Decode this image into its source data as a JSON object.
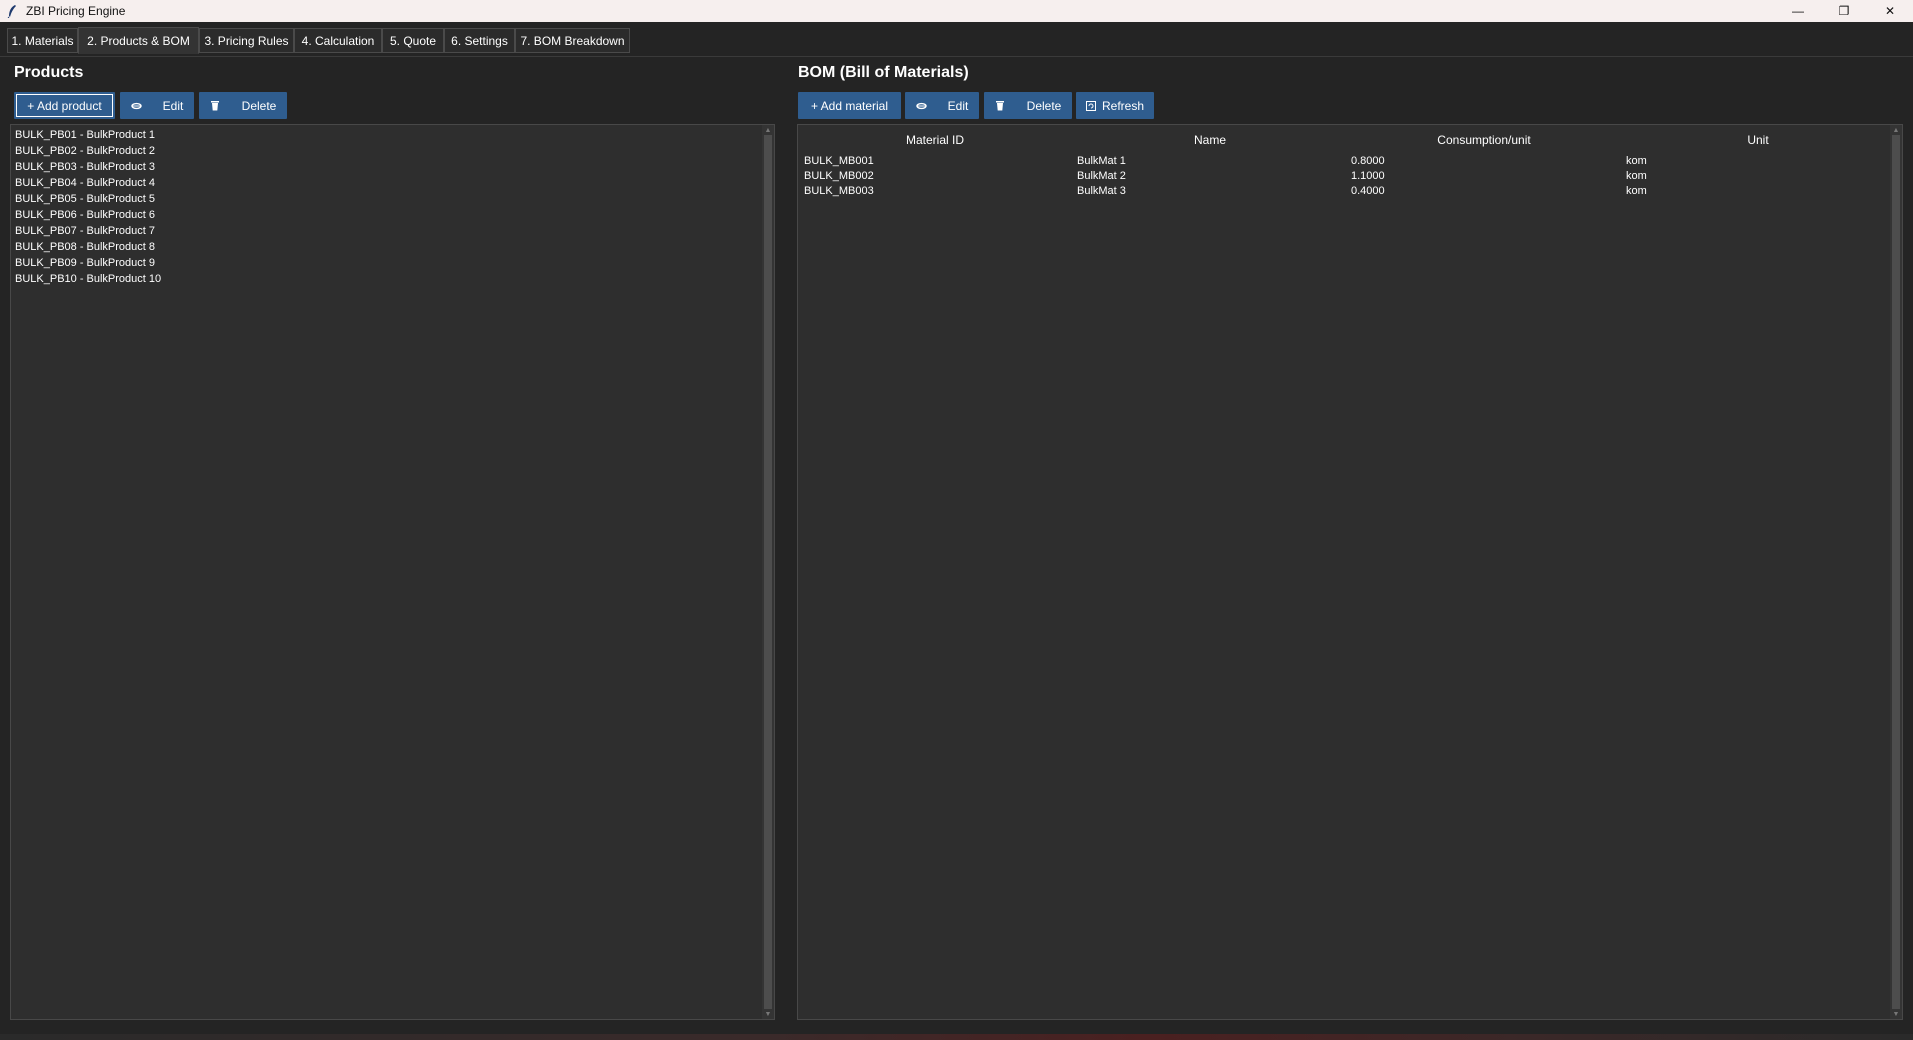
{
  "window": {
    "title": "ZBI Pricing Engine",
    "minimize_glyph": "—",
    "restore_glyph": "❐",
    "close_glyph": "✕"
  },
  "tabs": [
    {
      "label": "1. Materials"
    },
    {
      "label": "2. Products & BOM"
    },
    {
      "label": "3. Pricing Rules"
    },
    {
      "label": "4. Calculation"
    },
    {
      "label": "5. Quote"
    },
    {
      "label": "6. Settings"
    },
    {
      "label": "7. BOM Breakdown"
    }
  ],
  "active_tab": "2. Products & BOM",
  "products": {
    "title": "Products",
    "buttons": {
      "add": "+ Add product",
      "edit": "Edit",
      "delete": "Delete"
    },
    "items": [
      "BULK_PB01 - BulkProduct 1",
      "BULK_PB02 - BulkProduct 2",
      "BULK_PB03 - BulkProduct 3",
      "BULK_PB04 - BulkProduct 4",
      "BULK_PB05 - BulkProduct 5",
      "BULK_PB06 - BulkProduct 6",
      "BULK_PB07 - BulkProduct 7",
      "BULK_PB08 - BulkProduct 8",
      "BULK_PB09 - BulkProduct 9",
      "BULK_PB10 - BulkProduct 10"
    ]
  },
  "bom": {
    "title": "BOM (Bill of Materials)",
    "buttons": {
      "add": "+ Add material",
      "edit": "Edit",
      "delete": "Delete",
      "refresh": "Refresh"
    },
    "columns": [
      "Material ID",
      "Name",
      "Consumption/unit",
      "Unit"
    ],
    "rows": [
      [
        "BULK_MB001",
        "BulkMat 1",
        "0.8000",
        "kom"
      ],
      [
        "BULK_MB002",
        "BulkMat 2",
        "1.1000",
        "kom"
      ],
      [
        "BULK_MB003",
        "BulkMat 3",
        "0.4000",
        "kom"
      ]
    ]
  },
  "colors": {
    "button_bg": "#2f5d8f",
    "panel_bg": "#2e2e2e",
    "window_bg": "#242424",
    "titlebar_bg": "#f6efee"
  },
  "icons": {
    "edit": "pencil-icon",
    "delete": "trash-icon",
    "refresh": "refresh-icon"
  }
}
